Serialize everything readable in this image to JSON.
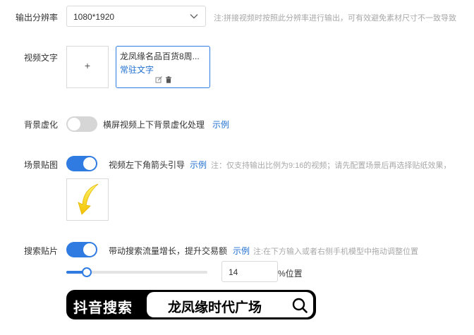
{
  "resolution": {
    "label": "输出分辨率",
    "value": "1080*1920",
    "note": "注:拼接视频时按照此分辨率进行输出，可有效避免素材尺寸不一致导致"
  },
  "video_text": {
    "label": "视频文字",
    "add_symbol": "+",
    "card_title": "龙凤缘名品百货8周...",
    "card_sub": "常驻文字",
    "edit_icon": "edit-icon",
    "delete_icon": "trash-icon"
  },
  "bg_blur": {
    "label": "背景虚化",
    "enabled": false,
    "desc": "横屏视频上下背景虚化处理",
    "example": "示例"
  },
  "scene_sticker": {
    "label": "场景贴图",
    "enabled": true,
    "desc": "视频左下角箭头引导",
    "example": "示例",
    "note": "注：仅支持输出比例为9:16的视频；请先配置场景后再选择贴纸效果，",
    "thumb_icon": "yellow-arrow-icon"
  },
  "search_sticker": {
    "label": "搜索贴片",
    "enabled": true,
    "desc": "带动搜索流量增长，提升交易额",
    "example": "示例",
    "note": "注:在下方输入或者右侧手机模型中拖动调整位置",
    "slider_value": 14,
    "position_value": "14",
    "position_unit": "%位置",
    "banner_brand": "抖音搜索",
    "banner_query": "龙凤缘时代广场",
    "search_icon": "search-icon"
  },
  "colors": {
    "accent": "#2f7be2",
    "link": "#1f6fd1",
    "note": "#a8a8a8",
    "sticker_yellow": "#f6d11c"
  }
}
